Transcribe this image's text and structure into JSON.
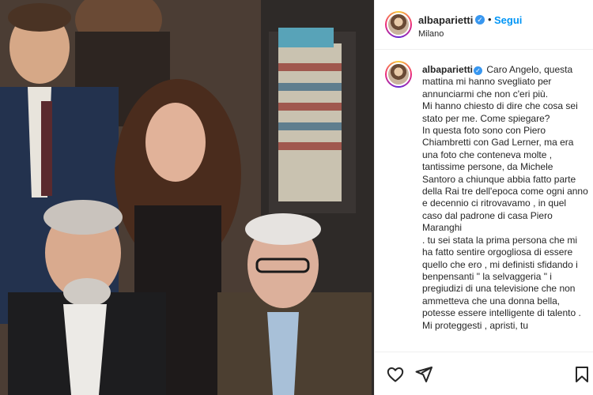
{
  "post": {
    "username": "albaparietti",
    "follow_label": "Segui",
    "separator": "•",
    "location": "Milano"
  },
  "caption": {
    "username": "albaparietti",
    "lines": [
      "Caro Angelo, questa mattina mi hanno svegliato per annunciarmi che non c'eri più.",
      "Mi hanno chiesto di dire che cosa sei stato per me. Come spiegare?",
      "In questa foto sono con Piero Chiambretti con Gad Lerner, ma era una foto che conteneva molte , tantissime persone, da Michele Santoro a chiunque abbia fatto parte della Rai tre dell'epoca come ogni anno e decennio ci ritrovavamo , in quel caso dal padrone di casa Piero Maranghi",
      ". tu sei stata la prima persona che mi ha fatto sentire orgogliosa di essere quello che ero , mi definisti sfidando i benpensanti \" la selvaggeria \" i pregiudizi di una televisione che non ammetteva che una donna bella, potesse essere intelligente di talento .",
      "Mi proteggesti , apristi, tu"
    ]
  },
  "icons": {
    "verified": "verified-badge",
    "like": "heart-icon",
    "share": "paper-plane-icon",
    "save": "bookmark-icon"
  },
  "colors": {
    "follow": "#0095f6",
    "verified": "#3897f0",
    "border": "#efefef"
  }
}
